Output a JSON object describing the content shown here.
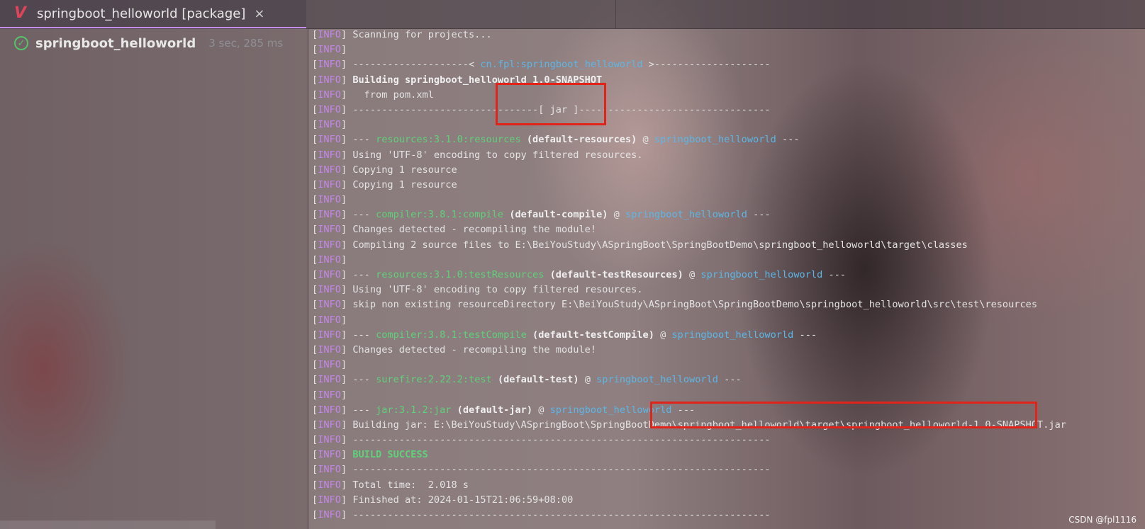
{
  "tab": {
    "title": "springboot_helloworld [package]",
    "close": "×",
    "icon": "maven-v-icon"
  },
  "run": {
    "name": "springboot_helloworld",
    "time": "3 sec, 285 ms",
    "status_icon": "check-circle-icon"
  },
  "colors": {
    "info": "#c487e8",
    "plugin": "#5fd17a",
    "project": "#5bb7e6",
    "success": "#5fd17a",
    "highlight_box": "#e2231a"
  },
  "console": {
    "level": "INFO",
    "lines": [
      [
        [
          "t",
          "Scanning for projects..."
        ]
      ],
      [],
      [
        [
          "t",
          "--------------------< "
        ],
        [
          "proj",
          "cn.fpl:springboot_helloworld"
        ],
        [
          "t",
          " >--------------------"
        ]
      ],
      [
        [
          "bold",
          "Building springboot_helloworld 1.0-SNAPSHOT"
        ]
      ],
      [
        [
          "t",
          "  from pom.xml"
        ]
      ],
      [
        [
          "t",
          "--------------------------------[ jar ]---------------------------------"
        ]
      ],
      [],
      [
        [
          "t",
          "--- "
        ],
        [
          "plugin",
          "resources:3.1.0:resources"
        ],
        [
          "t",
          " "
        ],
        [
          "bold",
          "(default-resources)"
        ],
        [
          "t",
          " @ "
        ],
        [
          "proj",
          "springboot_helloworld"
        ],
        [
          "t",
          " ---"
        ]
      ],
      [
        [
          "t",
          "Using 'UTF-8' encoding to copy filtered resources."
        ]
      ],
      [
        [
          "t",
          "Copying 1 resource"
        ]
      ],
      [
        [
          "t",
          "Copying 1 resource"
        ]
      ],
      [],
      [
        [
          "t",
          "--- "
        ],
        [
          "plugin",
          "compiler:3.8.1:compile"
        ],
        [
          "t",
          " "
        ],
        [
          "bold",
          "(default-compile)"
        ],
        [
          "t",
          " @ "
        ],
        [
          "proj",
          "springboot_helloworld"
        ],
        [
          "t",
          " ---"
        ]
      ],
      [
        [
          "t",
          "Changes detected - recompiling the module!"
        ]
      ],
      [
        [
          "t",
          "Compiling 2 source files to E:\\BeiYouStudy\\ASpringBoot\\SpringBootDemo\\springboot_helloworld\\target\\classes"
        ]
      ],
      [],
      [
        [
          "t",
          "--- "
        ],
        [
          "plugin",
          "resources:3.1.0:testResources"
        ],
        [
          "t",
          " "
        ],
        [
          "bold",
          "(default-testResources)"
        ],
        [
          "t",
          " @ "
        ],
        [
          "proj",
          "springboot_helloworld"
        ],
        [
          "t",
          " ---"
        ]
      ],
      [
        [
          "t",
          "Using 'UTF-8' encoding to copy filtered resources."
        ]
      ],
      [
        [
          "t",
          "skip non existing resourceDirectory E:\\BeiYouStudy\\ASpringBoot\\SpringBootDemo\\springboot_helloworld\\src\\test\\resources"
        ]
      ],
      [],
      [
        [
          "t",
          "--- "
        ],
        [
          "plugin",
          "compiler:3.8.1:testCompile"
        ],
        [
          "t",
          " "
        ],
        [
          "bold",
          "(default-testCompile)"
        ],
        [
          "t",
          " @ "
        ],
        [
          "proj",
          "springboot_helloworld"
        ],
        [
          "t",
          " ---"
        ]
      ],
      [
        [
          "t",
          "Changes detected - recompiling the module!"
        ]
      ],
      [],
      [
        [
          "t",
          "--- "
        ],
        [
          "plugin",
          "surefire:2.22.2:test"
        ],
        [
          "t",
          " "
        ],
        [
          "bold",
          "(default-test)"
        ],
        [
          "t",
          " @ "
        ],
        [
          "proj",
          "springboot_helloworld"
        ],
        [
          "t",
          " ---"
        ]
      ],
      [],
      [
        [
          "t",
          "--- "
        ],
        [
          "plugin",
          "jar:3.1.2:jar"
        ],
        [
          "t",
          " "
        ],
        [
          "bold",
          "(default-jar)"
        ],
        [
          "t",
          " @ "
        ],
        [
          "proj",
          "springboot_helloworld"
        ],
        [
          "t",
          " ---"
        ]
      ],
      [
        [
          "t",
          "Building jar: E:\\BeiYouStudy\\ASpringBoot\\SpringBootDemo\\springboot_helloworld\\target\\springboot_helloworld-1.0-SNAPSHOT.jar"
        ]
      ],
      [
        [
          "t",
          "------------------------------------------------------------------------"
        ]
      ],
      [
        [
          "success",
          "BUILD SUCCESS"
        ]
      ],
      [
        [
          "t",
          "------------------------------------------------------------------------"
        ]
      ],
      [
        [
          "t",
          "Total time:  2.018 s"
        ]
      ],
      [
        [
          "t",
          "Finished at: 2024-01-15T21:06:59+08:00"
        ]
      ],
      [
        [
          "t",
          "------------------------------------------------------------------------"
        ]
      ]
    ]
  },
  "watermark": "CSDN @fpl1116"
}
